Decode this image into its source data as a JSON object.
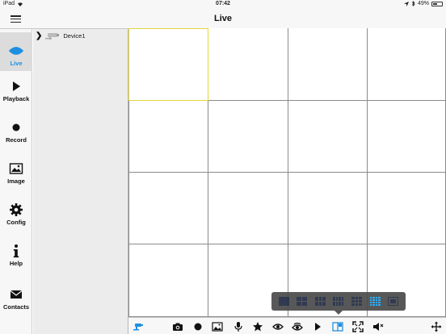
{
  "status_bar": {
    "device": "iPad",
    "time": "07:42",
    "battery": "49%"
  },
  "nav": {
    "title": "Live"
  },
  "sidebar": {
    "items": [
      {
        "label": "Live",
        "icon": "eye-icon",
        "active": true
      },
      {
        "label": "Playback",
        "icon": "play-icon",
        "active": false
      },
      {
        "label": "Record",
        "icon": "record-icon",
        "active": false
      },
      {
        "label": "Image",
        "icon": "image-icon",
        "active": false
      },
      {
        "label": "Config",
        "icon": "gear-icon",
        "active": false
      },
      {
        "label": "Help",
        "icon": "info-icon",
        "active": false
      },
      {
        "label": "Contacts",
        "icon": "mail-icon",
        "active": false
      }
    ]
  },
  "device_tree": {
    "devices": [
      {
        "name": "Device1",
        "icon": "camera-icon",
        "expanded": false
      }
    ]
  },
  "grid": {
    "rows": 4,
    "cols": 4,
    "selected_cell": 0
  },
  "layout_menu": {
    "options": [
      "1",
      "4",
      "6",
      "8",
      "9",
      "16",
      "custom"
    ],
    "selected": "16"
  },
  "toolbar": {
    "icons": [
      "camera-connect-icon",
      "snapshot-icon",
      "record-dot-icon",
      "image-gallery-icon",
      "microphone-icon",
      "favorite-star-icon",
      "eye-icon",
      "eye-multi-icon",
      "play-icon",
      "layout-icon",
      "fullscreen-icon",
      "mute-icon",
      "ptz-move-icon"
    ]
  },
  "colors": {
    "accent": "#1e8fe0",
    "selected_cell": "#e2d53a",
    "grid_line": "#8a8a8a"
  }
}
